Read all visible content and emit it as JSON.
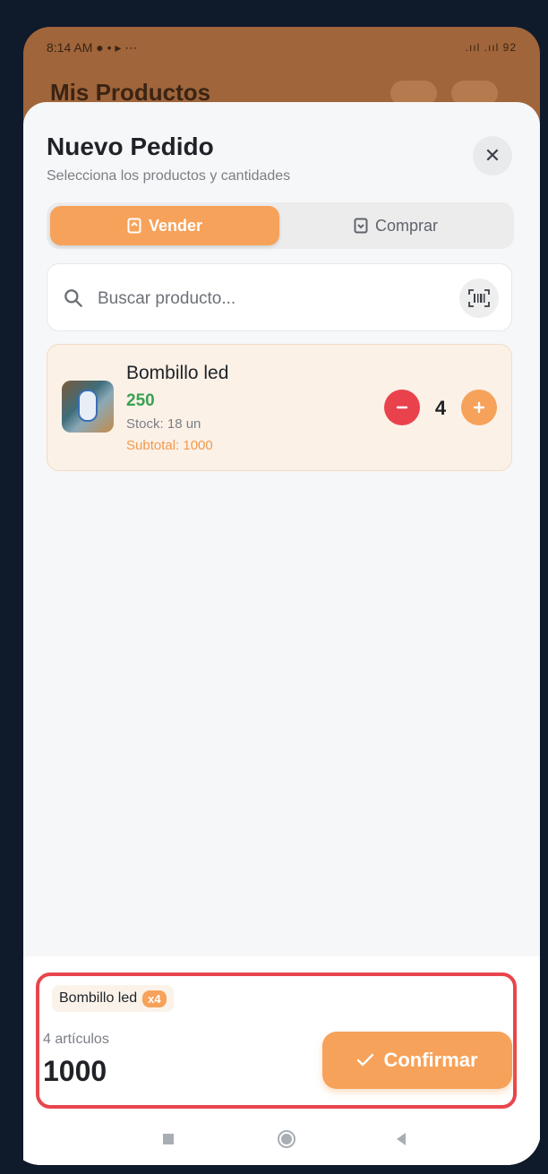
{
  "status_bar": {
    "time": "8:14 AM",
    "left_icons": "● • ▸ ⋯",
    "right": ".ııl .ııl 92"
  },
  "background": {
    "title": "Mis Productos"
  },
  "dialog": {
    "title": "Nuevo Pedido",
    "subtitle": "Selecciona los productos y cantidades",
    "close_icon": "✕",
    "tabs": [
      {
        "label": "Vender",
        "active": true
      },
      {
        "label": "Comprar",
        "active": false
      }
    ],
    "search": {
      "placeholder": "Buscar producto...",
      "value": ""
    },
    "products": [
      {
        "name": "Bombillo led",
        "price": "250",
        "stock": "Stock: 18 un",
        "subtotal": "Subtotal: 1000",
        "quantity": "4"
      }
    ],
    "summary": {
      "chip_name": "Bombillo led",
      "chip_qty": "x4",
      "items_count": "4 artículos",
      "total": "1000",
      "confirm_label": "Confirmar"
    }
  },
  "colors": {
    "accent": "#f6a25a",
    "danger": "#e9424d",
    "price_green": "#3aa153",
    "highlight_border": "#e8454d"
  }
}
